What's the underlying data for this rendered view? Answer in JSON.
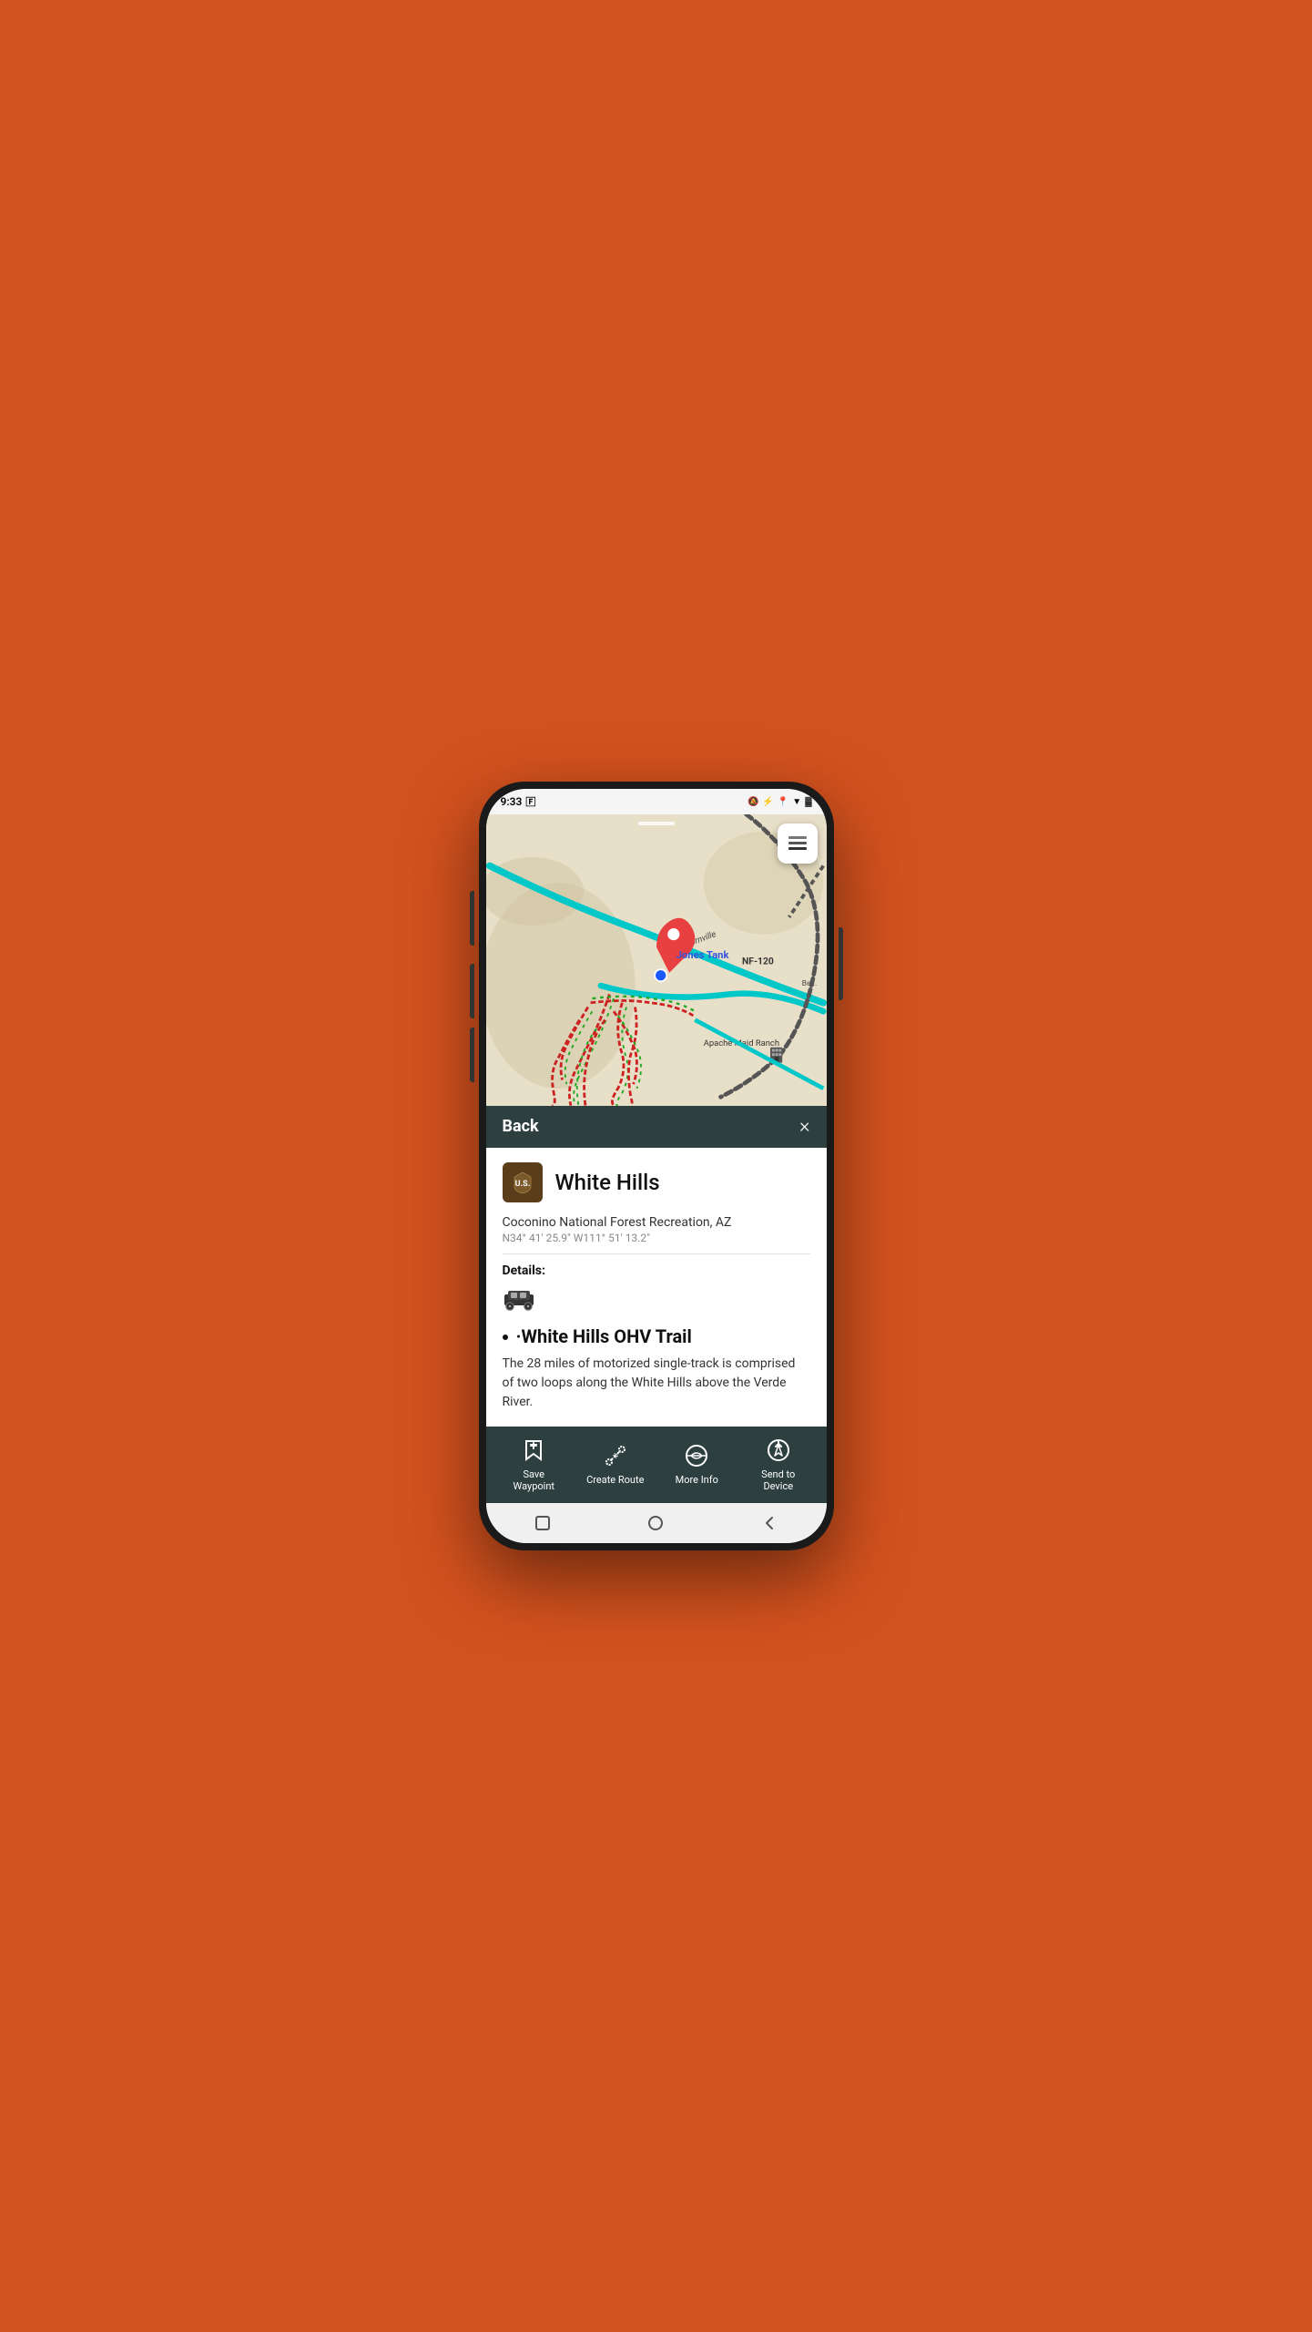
{
  "status_bar": {
    "time": "9:33",
    "icons": [
      "signal",
      "bluetooth",
      "location",
      "wifi",
      "battery"
    ]
  },
  "map": {
    "location_name": "Jones Tank",
    "label_nf": "NF-120",
    "label_cornville": "Cornville",
    "label_apache": "Apache Maid Ranch",
    "label_be": "Be..."
  },
  "sheet_header": {
    "back_label": "Back",
    "close_label": "×"
  },
  "place": {
    "name": "White Hills",
    "subtitle": "Coconino National Forest Recreation, AZ",
    "coords": "N34° 41' 25.9\" W111° 51' 13.2\"",
    "details_label": "Details:",
    "trail_name": "·White Hills OHV Trail",
    "trail_desc": "The 28 miles of motorized single-track is comprised of two loops along the White Hills above the Verde River."
  },
  "toolbar": {
    "buttons": [
      {
        "id": "save-waypoint",
        "label": "Save\nWaypoint",
        "icon": "waypoint"
      },
      {
        "id": "create-route",
        "label": "Create Route",
        "icon": "route"
      },
      {
        "id": "more-info",
        "label": "More Info",
        "icon": "globe"
      },
      {
        "id": "send-to-device",
        "label": "Send to\nDevice",
        "icon": "compass"
      }
    ]
  },
  "nav_bar": {
    "buttons": [
      "square",
      "circle",
      "triangle-left"
    ]
  }
}
